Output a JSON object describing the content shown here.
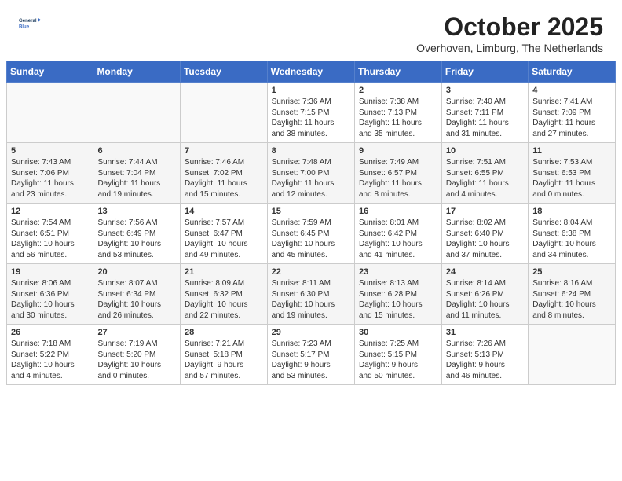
{
  "header": {
    "logo_line1": "General",
    "logo_line2": "Blue",
    "month_title": "October 2025",
    "location": "Overhoven, Limburg, The Netherlands"
  },
  "days_of_week": [
    "Sunday",
    "Monday",
    "Tuesday",
    "Wednesday",
    "Thursday",
    "Friday",
    "Saturday"
  ],
  "weeks": [
    [
      {
        "day": "",
        "detail": ""
      },
      {
        "day": "",
        "detail": ""
      },
      {
        "day": "",
        "detail": ""
      },
      {
        "day": "1",
        "detail": "Sunrise: 7:36 AM\nSunset: 7:15 PM\nDaylight: 11 hours\nand 38 minutes."
      },
      {
        "day": "2",
        "detail": "Sunrise: 7:38 AM\nSunset: 7:13 PM\nDaylight: 11 hours\nand 35 minutes."
      },
      {
        "day": "3",
        "detail": "Sunrise: 7:40 AM\nSunset: 7:11 PM\nDaylight: 11 hours\nand 31 minutes."
      },
      {
        "day": "4",
        "detail": "Sunrise: 7:41 AM\nSunset: 7:09 PM\nDaylight: 11 hours\nand 27 minutes."
      }
    ],
    [
      {
        "day": "5",
        "detail": "Sunrise: 7:43 AM\nSunset: 7:06 PM\nDaylight: 11 hours\nand 23 minutes."
      },
      {
        "day": "6",
        "detail": "Sunrise: 7:44 AM\nSunset: 7:04 PM\nDaylight: 11 hours\nand 19 minutes."
      },
      {
        "day": "7",
        "detail": "Sunrise: 7:46 AM\nSunset: 7:02 PM\nDaylight: 11 hours\nand 15 minutes."
      },
      {
        "day": "8",
        "detail": "Sunrise: 7:48 AM\nSunset: 7:00 PM\nDaylight: 11 hours\nand 12 minutes."
      },
      {
        "day": "9",
        "detail": "Sunrise: 7:49 AM\nSunset: 6:57 PM\nDaylight: 11 hours\nand 8 minutes."
      },
      {
        "day": "10",
        "detail": "Sunrise: 7:51 AM\nSunset: 6:55 PM\nDaylight: 11 hours\nand 4 minutes."
      },
      {
        "day": "11",
        "detail": "Sunrise: 7:53 AM\nSunset: 6:53 PM\nDaylight: 11 hours\nand 0 minutes."
      }
    ],
    [
      {
        "day": "12",
        "detail": "Sunrise: 7:54 AM\nSunset: 6:51 PM\nDaylight: 10 hours\nand 56 minutes."
      },
      {
        "day": "13",
        "detail": "Sunrise: 7:56 AM\nSunset: 6:49 PM\nDaylight: 10 hours\nand 53 minutes."
      },
      {
        "day": "14",
        "detail": "Sunrise: 7:57 AM\nSunset: 6:47 PM\nDaylight: 10 hours\nand 49 minutes."
      },
      {
        "day": "15",
        "detail": "Sunrise: 7:59 AM\nSunset: 6:45 PM\nDaylight: 10 hours\nand 45 minutes."
      },
      {
        "day": "16",
        "detail": "Sunrise: 8:01 AM\nSunset: 6:42 PM\nDaylight: 10 hours\nand 41 minutes."
      },
      {
        "day": "17",
        "detail": "Sunrise: 8:02 AM\nSunset: 6:40 PM\nDaylight: 10 hours\nand 37 minutes."
      },
      {
        "day": "18",
        "detail": "Sunrise: 8:04 AM\nSunset: 6:38 PM\nDaylight: 10 hours\nand 34 minutes."
      }
    ],
    [
      {
        "day": "19",
        "detail": "Sunrise: 8:06 AM\nSunset: 6:36 PM\nDaylight: 10 hours\nand 30 minutes."
      },
      {
        "day": "20",
        "detail": "Sunrise: 8:07 AM\nSunset: 6:34 PM\nDaylight: 10 hours\nand 26 minutes."
      },
      {
        "day": "21",
        "detail": "Sunrise: 8:09 AM\nSunset: 6:32 PM\nDaylight: 10 hours\nand 22 minutes."
      },
      {
        "day": "22",
        "detail": "Sunrise: 8:11 AM\nSunset: 6:30 PM\nDaylight: 10 hours\nand 19 minutes."
      },
      {
        "day": "23",
        "detail": "Sunrise: 8:13 AM\nSunset: 6:28 PM\nDaylight: 10 hours\nand 15 minutes."
      },
      {
        "day": "24",
        "detail": "Sunrise: 8:14 AM\nSunset: 6:26 PM\nDaylight: 10 hours\nand 11 minutes."
      },
      {
        "day": "25",
        "detail": "Sunrise: 8:16 AM\nSunset: 6:24 PM\nDaylight: 10 hours\nand 8 minutes."
      }
    ],
    [
      {
        "day": "26",
        "detail": "Sunrise: 7:18 AM\nSunset: 5:22 PM\nDaylight: 10 hours\nand 4 minutes."
      },
      {
        "day": "27",
        "detail": "Sunrise: 7:19 AM\nSunset: 5:20 PM\nDaylight: 10 hours\nand 0 minutes."
      },
      {
        "day": "28",
        "detail": "Sunrise: 7:21 AM\nSunset: 5:18 PM\nDaylight: 9 hours\nand 57 minutes."
      },
      {
        "day": "29",
        "detail": "Sunrise: 7:23 AM\nSunset: 5:17 PM\nDaylight: 9 hours\nand 53 minutes."
      },
      {
        "day": "30",
        "detail": "Sunrise: 7:25 AM\nSunset: 5:15 PM\nDaylight: 9 hours\nand 50 minutes."
      },
      {
        "day": "31",
        "detail": "Sunrise: 7:26 AM\nSunset: 5:13 PM\nDaylight: 9 hours\nand 46 minutes."
      },
      {
        "day": "",
        "detail": ""
      }
    ]
  ]
}
